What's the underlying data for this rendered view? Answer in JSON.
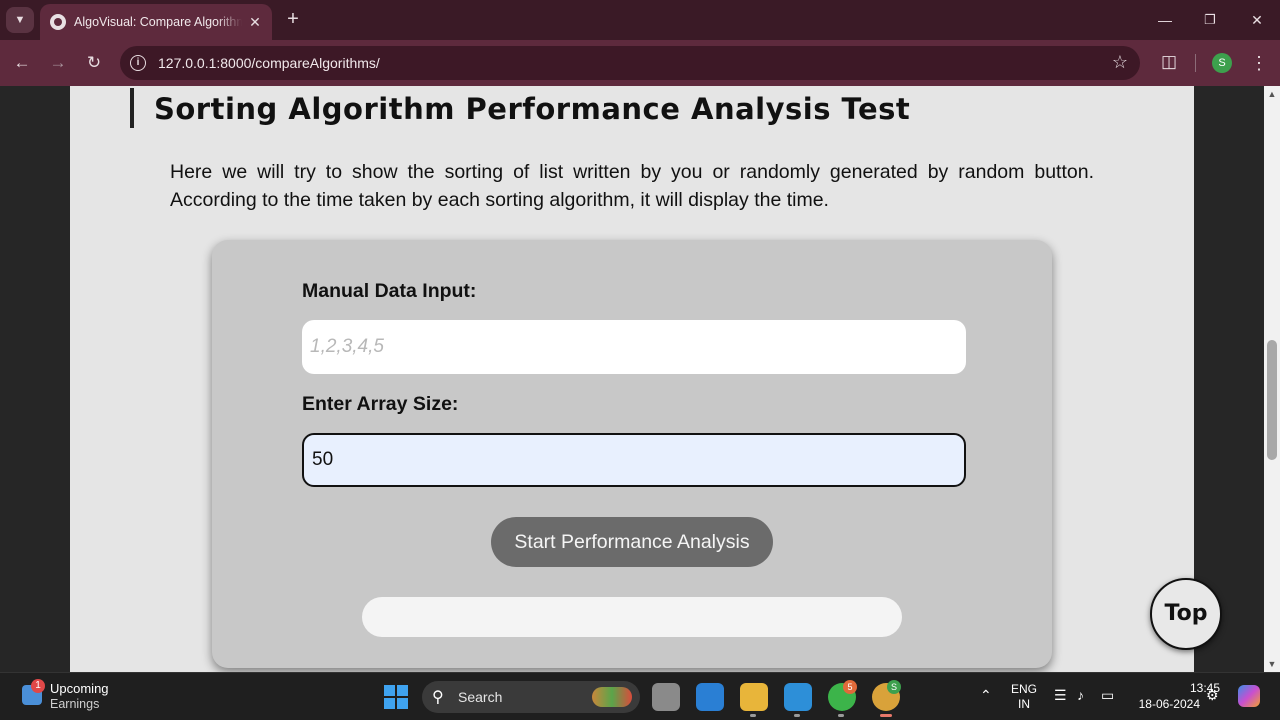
{
  "browser": {
    "tab_title": "AlgoVisual: Compare Algorithms",
    "new_tab": "+",
    "tab_close": "✕",
    "url": "127.0.0.1:8000/compareAlgorithms/",
    "profile_initial": "S"
  },
  "page": {
    "heading": "Sorting Algorithm Performance Analysis Test",
    "intro": "Here we will try to show the sorting of list written by you or randomly generated by random button. According to the time taken by each sorting algorithm, it will display the time.",
    "manual_label": "Manual Data Input:",
    "manual_placeholder": "1,2,3,4,5",
    "manual_value": "",
    "size_label": "Enter Array Size:",
    "size_value": "50",
    "start_button": "Start Performance Analysis",
    "top_button": "Top"
  },
  "taskbar": {
    "weather_title": "Upcoming",
    "weather_subtitle": "Earnings",
    "weather_badge": "1",
    "search_placeholder": "Search",
    "whatsapp_badge": "5",
    "chrome_badge": "S",
    "lang_line1": "ENG",
    "lang_line2": "IN",
    "time": "13:45",
    "date": "18-06-2024"
  },
  "colors": {
    "chrome_frame": "#3a1a26",
    "chrome_toolbar": "#5e2a3d",
    "page_bg": "#e5e5e5",
    "card_bg": "#c8c8c8",
    "button_bg": "#6b6b6b"
  }
}
